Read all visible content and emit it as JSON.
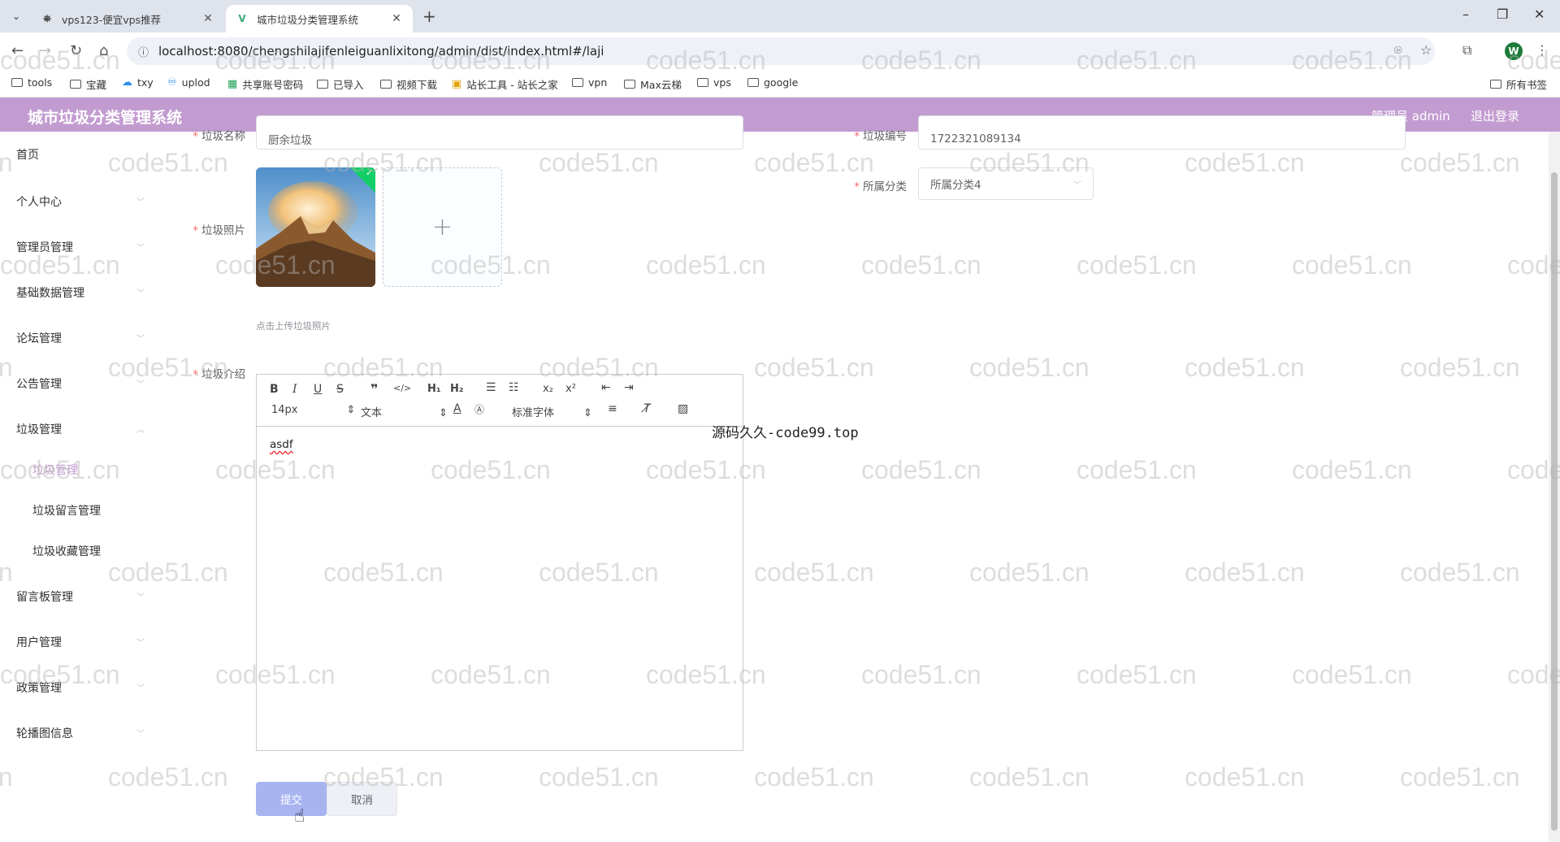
{
  "browser": {
    "tabs": [
      {
        "title": "vps123-便宜vps推荐",
        "active": false
      },
      {
        "title": "城市垃圾分类管理系统",
        "active": true
      }
    ],
    "url": "localhost:8080/chengshilajifenleiguanlixitong/admin/dist/index.html#/laji",
    "avatar_letter": "W",
    "bookmarks": [
      "tools",
      "宝藏",
      "txy",
      "uplod",
      "共享账号密码",
      "已导入",
      "视频下载",
      "站长工具 - 站长之家",
      "vpn",
      "Max云梯",
      "vps",
      "google"
    ],
    "all_bookmarks": "所有书签"
  },
  "header": {
    "title": "城市垃圾分类管理系统",
    "user": "管理员 admin",
    "logout": "退出登录"
  },
  "sidebar": {
    "items": [
      {
        "label": "首页"
      },
      {
        "label": "个人中心"
      },
      {
        "label": "管理员管理"
      },
      {
        "label": "基础数据管理"
      },
      {
        "label": "论坛管理"
      },
      {
        "label": "公告管理"
      },
      {
        "label": "垃圾管理"
      },
      {
        "label": "留言板管理"
      },
      {
        "label": "用户管理"
      },
      {
        "label": "政策管理"
      },
      {
        "label": "轮播图信息"
      }
    ],
    "submenu": [
      {
        "label": "垃圾管理",
        "active": true
      },
      {
        "label": "垃圾留言管理"
      },
      {
        "label": "垃圾收藏管理"
      }
    ]
  },
  "form": {
    "name_label": "垃圾名称",
    "name_value": "厨余垃圾",
    "code_label": "垃圾编号",
    "code_value": "1722321089134",
    "category_label": "所属分类",
    "category_value": "所属分类4",
    "photo_label": "垃圾照片",
    "upload_tip": "点击上传垃圾照片",
    "intro_label": "垃圾介绍",
    "editor": {
      "font_size": "14px",
      "block": "文本",
      "font": "标准字体",
      "content": "asdf"
    },
    "submit": "提交",
    "cancel": "取消"
  },
  "overlay_text": "源码久久-code99.top",
  "watermark": "code51.cn",
  "colors": {
    "header_bg": "#c29bd0",
    "submit_bg": "#a8b4f0",
    "required": "#f56c6c"
  }
}
